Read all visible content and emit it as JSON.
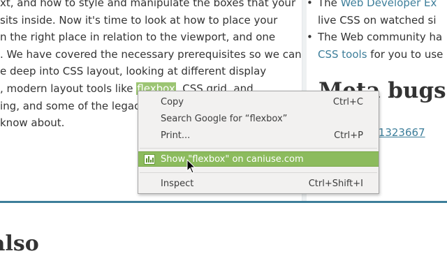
{
  "article": {
    "lines": [
      "xt, and how to style and manipulate the boxes that your",
      "sits inside. Now it's time to look at how to place your",
      "n the right place in relation to the viewport, and one",
      ". We have covered the necessary prerequisites so we can",
      "e deep into CSS layout, looking at different display",
      "ing, and some of the legacy",
      "know about."
    ],
    "line6": {
      "before": ", modern layout tools like ",
      "highlight": "flexbox",
      "after": ", CSS grid, and"
    }
  },
  "sidebar": {
    "item1": {
      "prefix": "The ",
      "link": "Web Developer Ex",
      "line2": "live CSS on watched si"
    },
    "item2": {
      "prefix": "The Web community ha",
      "link": "CSS tools",
      "suffix": " for you to use"
    },
    "bullet": "•",
    "heading": "Meta bugs",
    "bug_link": "ug 1323667"
  },
  "section": {
    "heading": "also"
  },
  "context_menu": {
    "items": [
      {
        "label": "Copy",
        "shortcut": "Ctrl+C"
      },
      {
        "label": "Search Google for “flexbox”",
        "shortcut": ""
      },
      {
        "label": "Print...",
        "shortcut": "Ctrl+P"
      },
      {
        "label": "Show \"flexbox\" on caniuse.com",
        "shortcut": ""
      },
      {
        "label": "Inspect",
        "shortcut": "Ctrl+Shift+I"
      }
    ],
    "active_index": 3,
    "caniuse_icon": "caniuse-icon"
  },
  "colors": {
    "link": "#3d7e9a",
    "highlight": "#9cc573",
    "menu_active": "#8cbb5d",
    "divider": "#3d7e9a"
  }
}
